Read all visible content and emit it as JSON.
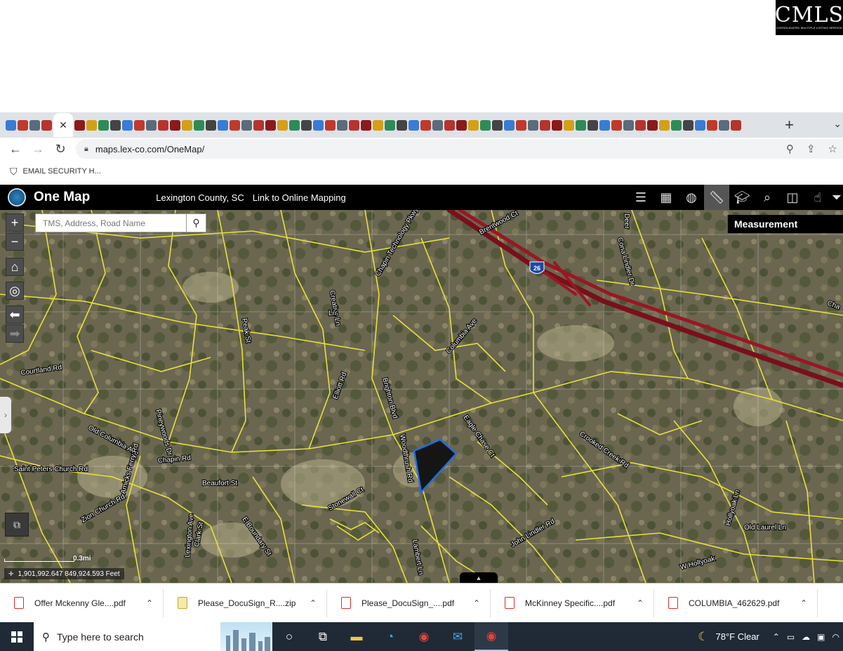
{
  "logo": {
    "text": "CMLS",
    "subtitle": "CONSOLIDATED MULTIPLE LISTING SERVICE"
  },
  "browser": {
    "url": "maps.lex-co.com/OneMap/",
    "bookmark": "EMAIL SECURITY H...",
    "tab_icon_count": 60,
    "new_tab_glyph": "+"
  },
  "app": {
    "title": "One Map",
    "county": "Lexington County, SC",
    "link": "Link to Online Mapping",
    "tools": [
      "list-icon",
      "grid-icon",
      "globe-icon",
      "ruler-icon",
      "graduation-cap-icon",
      "search-map-icon",
      "compare-icon",
      "hand-pointer-icon",
      "filter-icon"
    ],
    "active_tool": "ruler-icon"
  },
  "map": {
    "search_placeholder": "TMS, Address, Road Name",
    "measurement_panel": "Measurement",
    "scale_label": "0.3mi",
    "coordinates": "1,901,992.647 849,924.593 Feet",
    "road_labels": [
      {
        "text": "Brentwood Ct"
      },
      {
        "text": "Chapin Technology Pkwy"
      },
      {
        "text": "Creative Ln"
      },
      {
        "text": "Peak St"
      },
      {
        "text": "Courtland Rd"
      },
      {
        "text": "Elliott Rd"
      },
      {
        "text": "Brighton Blvd"
      },
      {
        "text": "Columbia Ave"
      },
      {
        "text": "Eagle Chase Ct"
      },
      {
        "text": "Woodthrush Rd"
      },
      {
        "text": "Crooked Creek Rd"
      },
      {
        "text": "Old Columbia Ave"
      },
      {
        "text": "Chapin Rd"
      },
      {
        "text": "Beaufort St"
      },
      {
        "text": "Saint Peters Church Rd"
      },
      {
        "text": "Amicks Ferry Rd"
      },
      {
        "text": "Zion Church Rd"
      },
      {
        "text": "Lexington Ave"
      },
      {
        "text": "Clark St"
      },
      {
        "text": "E Boundary St"
      },
      {
        "text": "Stonewall Ct"
      },
      {
        "text": "John Lindler Rd"
      },
      {
        "text": "Hollyoak Ln"
      },
      {
        "text": "Old Laurel Ln"
      },
      {
        "text": "W Hollyoak"
      },
      {
        "text": "Lambert Ln"
      },
      {
        "text": "Pineywoods Dr"
      },
      {
        "text": "Cona Lindler Dr"
      },
      {
        "text": "Deer"
      },
      {
        "text": "Cha"
      },
      {
        "text": "Ln"
      }
    ],
    "interstate_shield": "26"
  },
  "downloads": [
    {
      "name": "Offer Mckenny Gle....pdf",
      "type": "pdf"
    },
    {
      "name": "Please_DocuSign_R....zip",
      "type": "zip"
    },
    {
      "name": "Please_DocuSign_....pdf",
      "type": "pdf"
    },
    {
      "name": "McKinney Specific....pdf",
      "type": "pdf"
    },
    {
      "name": "COLUMBIA_462629.pdf",
      "type": "pdf"
    }
  ],
  "taskbar": {
    "search_placeholder": "Type here to search",
    "apps": [
      "cortana-icon",
      "task-view-icon",
      "file-explorer-icon",
      "edge-icon",
      "chrome-icon",
      "mail-icon",
      "chrome-profile-icon"
    ],
    "weather": "78°F  Clear"
  }
}
